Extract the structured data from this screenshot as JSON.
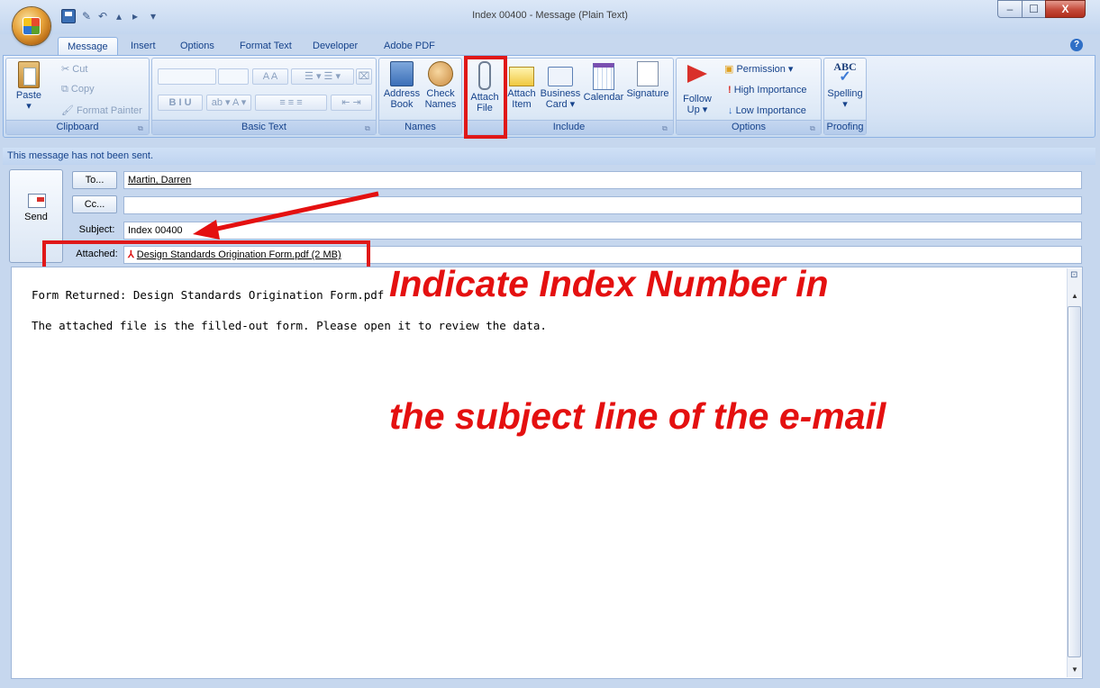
{
  "window": {
    "title": "Index 00400 - Message (Plain Text)",
    "min_glyph": "–",
    "max_glyph": "☐",
    "close_glyph": "X"
  },
  "tabs": [
    {
      "label": "Message",
      "active": true
    },
    {
      "label": "Insert"
    },
    {
      "label": "Options"
    },
    {
      "label": "Format Text"
    },
    {
      "label": "Developer"
    },
    {
      "label": "Adobe PDF"
    }
  ],
  "ribbon": {
    "clipboard": {
      "label": "Clipboard",
      "paste": "Paste",
      "cut": "Cut",
      "copy": "Copy",
      "format_painter": "Format Painter"
    },
    "basic_text": {
      "label": "Basic Text"
    },
    "names": {
      "label": "Names",
      "address_book": [
        "Address",
        "Book"
      ],
      "check_names": [
        "Check",
        "Names"
      ]
    },
    "include": {
      "label": "Include",
      "attach_file": [
        "Attach",
        "File"
      ],
      "attach_item": [
        "Attach",
        "Item"
      ],
      "business_card": [
        "Business",
        "Card ▾"
      ],
      "calendar": "Calendar",
      "signature": "Signature"
    },
    "options": {
      "label": "Options",
      "follow_up": [
        "Follow",
        "Up ▾"
      ],
      "permission": "Permission ▾",
      "high_importance": "High Importance",
      "low_importance": "Low Importance"
    },
    "proofing": {
      "label": "Proofing",
      "spelling": "Spelling"
    }
  },
  "message": {
    "status": "This message has not been sent.",
    "send_label": "Send",
    "to_label": "To...",
    "cc_label": "Cc...",
    "subject_label": "Subject:",
    "attached_label": "Attached:",
    "to_value": "Martin, Darren",
    "cc_value": "",
    "subject_value": "Index 00400",
    "attachment": "Design Standards Origination Form.pdf (2 MB)",
    "body_lines": [
      "Form Returned: Design Standards Origination Form.pdf",
      "The attached file is the filled-out form. Please open it to review the data."
    ]
  },
  "annotation": {
    "line1": "Indicate Index Number in",
    "line2": "the subject line of the e-mail",
    "color": "#e41010"
  },
  "icons": [
    "office-button-icon",
    "save-icon",
    "undo-icon",
    "redo-icon",
    "paste-icon",
    "cut-icon",
    "copy-icon",
    "format-painter-icon",
    "address-book-icon",
    "check-names-icon",
    "paperclip-icon",
    "envelope-icon",
    "business-card-icon",
    "calendar-icon",
    "signature-icon",
    "flag-icon",
    "permission-icon",
    "high-importance-icon",
    "low-importance-icon",
    "spelling-icon",
    "send-icon",
    "pdf-icon",
    "help-icon"
  ]
}
